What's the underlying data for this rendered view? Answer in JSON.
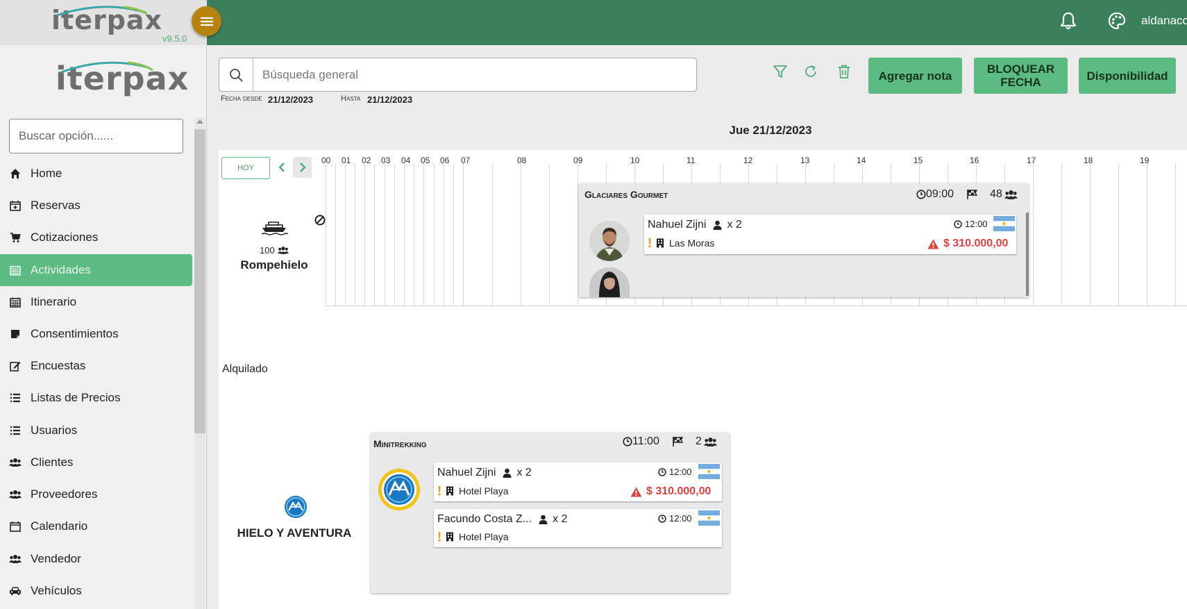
{
  "app": {
    "logo_text": "iterpax",
    "version": "v9.5.0",
    "user_name": "aldanaco"
  },
  "sidebar": {
    "search_placeholder": "Buscar opción......",
    "items": [
      {
        "label": "Home",
        "icon": "home-icon"
      },
      {
        "label": "Reservas",
        "icon": "calendar-plus-icon"
      },
      {
        "label": "Cotizaciones",
        "icon": "cart-icon"
      },
      {
        "label": "Actividades",
        "icon": "calendar-icon",
        "active": true
      },
      {
        "label": "Itinerario",
        "icon": "calendar-icon"
      },
      {
        "label": "Consentimientos",
        "icon": "note-icon"
      },
      {
        "label": "Encuestas",
        "icon": "edit-icon"
      },
      {
        "label": "Listas de Precios",
        "icon": "list-icon"
      },
      {
        "label": "Usuarios",
        "icon": "list-icon"
      },
      {
        "label": "Clientes",
        "icon": "users-icon"
      },
      {
        "label": "Proveedores",
        "icon": "users-icon"
      },
      {
        "label": "Calendario",
        "icon": "calendar-empty-icon"
      },
      {
        "label": "Vendedor",
        "icon": "users-icon"
      },
      {
        "label": "Vehículos",
        "icon": "car-icon"
      }
    ]
  },
  "toolbar": {
    "search_placeholder": "Búsqueda general",
    "date_from_label": "Fecha desde",
    "date_from": "21/12/2023",
    "date_to_label": "Hasta",
    "date_to": "21/12/2023",
    "buttons": {
      "add_note": "Agregar nota",
      "block_date_line1": "BLOQUEAR",
      "block_date_line2": "FECHA",
      "availability": "Disponibilidad"
    }
  },
  "schedule": {
    "day_title": "Jue 21/12/2023",
    "today_label": "HOY",
    "hours": [
      "00",
      "01",
      "02",
      "03",
      "04",
      "05",
      "06",
      "07",
      "08",
      "09",
      "10",
      "11",
      "12",
      "13",
      "14",
      "15",
      "16",
      "17",
      "18",
      "19"
    ],
    "rental_label": "Alquilado"
  },
  "resources": [
    {
      "name": "Rompehielo",
      "capacity": "100",
      "icon": "ship-icon"
    },
    {
      "name": "HIELO Y AVENTURA",
      "icon": "company-logo"
    }
  ],
  "activities": [
    {
      "title": "Glaciares Gourmet",
      "time": "09:00",
      "pax_count": "48",
      "bookings": [
        {
          "name": "Nahuel Zijni",
          "qty": "x 2",
          "time": "12:00",
          "hotel": "Las Moras",
          "price": "$ 310.000,00"
        }
      ]
    },
    {
      "title": "Minitrekking",
      "time": "11:00",
      "pax_count": "2",
      "bookings": [
        {
          "name": "Nahuel Zijni",
          "qty": "x 2",
          "time": "12:00",
          "hotel": "Hotel Playa",
          "price": "$ 310.000,00"
        },
        {
          "name": "Facundo Costa Z...",
          "qty": "x 2",
          "time": "12:00",
          "hotel": "Hotel Playa"
        }
      ]
    }
  ],
  "colors": {
    "topbar": "#3b805b",
    "accent": "#5cba83",
    "menu_button": "#b8820e",
    "price_alert": "#e0403e",
    "warning": "#f0a020"
  }
}
